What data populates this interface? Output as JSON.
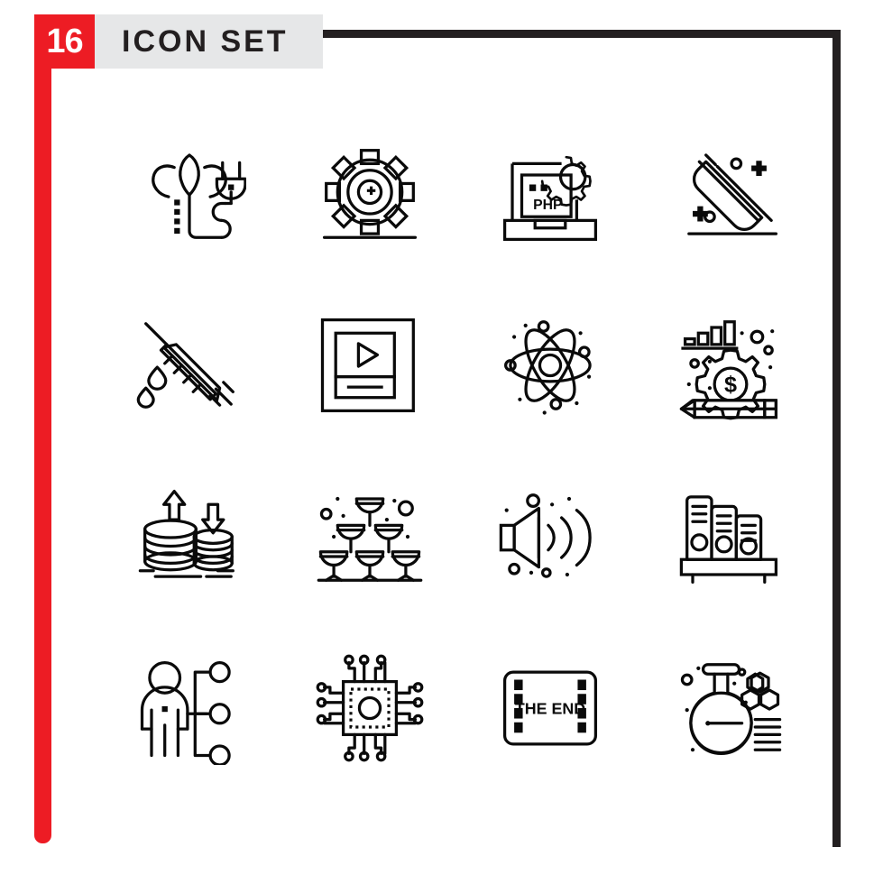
{
  "header": {
    "count": "16",
    "title": "ICON SET",
    "count_bg": "#ed1c24",
    "band_bg": "#e6e7e8",
    "title_color": "#231f20"
  },
  "frame": {
    "accent_color": "#ed1c24",
    "border_color": "#231f20"
  },
  "grid": {
    "columns": 4,
    "rows": 4,
    "stroke_color": "#0a0a0a",
    "style": "outline"
  },
  "icons": [
    {
      "index": 1,
      "name": "eco-energy-plug-icon",
      "label": "Eco Energy Plug"
    },
    {
      "index": 2,
      "name": "gear-settings-icon",
      "label": "Gear Settings"
    },
    {
      "index": 3,
      "name": "php-development-icon",
      "label": "PHP Development",
      "text": "PHP"
    },
    {
      "index": 4,
      "name": "broom-cleaning-icon",
      "label": "Broom Cleaning"
    },
    {
      "index": 5,
      "name": "syringe-injection-icon",
      "label": "Syringe Injection"
    },
    {
      "index": 6,
      "name": "video-player-icon",
      "label": "Video Player"
    },
    {
      "index": 7,
      "name": "atom-science-icon",
      "label": "Atom Science"
    },
    {
      "index": 8,
      "name": "business-management-icon",
      "label": "Business Management",
      "text": "$"
    },
    {
      "index": 9,
      "name": "coin-stack-transfer-icon",
      "label": "Coin Stack Transfer"
    },
    {
      "index": 10,
      "name": "champagne-pyramid-icon",
      "label": "Champagne Pyramid"
    },
    {
      "index": 11,
      "name": "speaker-volume-icon",
      "label": "Speaker Volume"
    },
    {
      "index": 12,
      "name": "archive-binders-icon",
      "label": "Archive Binders"
    },
    {
      "index": 13,
      "name": "user-network-icon",
      "label": "User Network"
    },
    {
      "index": 14,
      "name": "cpu-processor-icon",
      "label": "CPU Processor"
    },
    {
      "index": 15,
      "name": "the-end-film-icon",
      "label": "The End Film",
      "text": "THE END"
    },
    {
      "index": 16,
      "name": "chemistry-flask-icon",
      "label": "Chemistry Flask"
    }
  ]
}
